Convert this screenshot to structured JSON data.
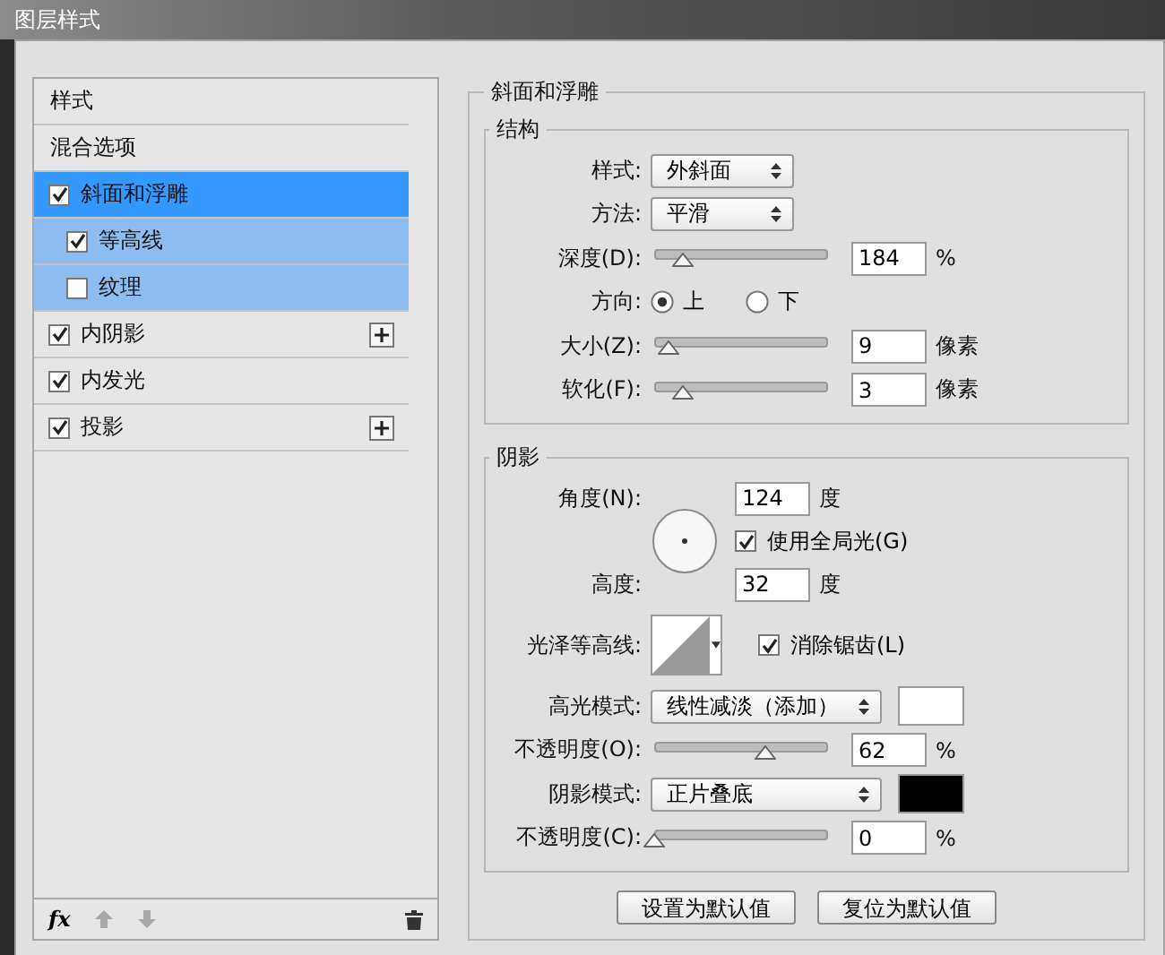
{
  "window": {
    "title": "图层样式"
  },
  "sidebar": {
    "items": [
      {
        "kind": "plain",
        "label": "样式",
        "selected": false
      },
      {
        "kind": "plain",
        "label": "混合选项",
        "selected": false
      },
      {
        "kind": "check",
        "label": "斜面和浮雕",
        "checked": true,
        "selected": true,
        "addable": false,
        "children": [
          {
            "label": "等高线",
            "checked": true,
            "selected": false
          },
          {
            "label": "纹理",
            "checked": false,
            "selected": false
          }
        ]
      },
      {
        "kind": "check",
        "label": "内阴影",
        "checked": true,
        "selected": false,
        "addable": true
      },
      {
        "kind": "check",
        "label": "内发光",
        "checked": true,
        "selected": false,
        "addable": false
      },
      {
        "kind": "check",
        "label": "投影",
        "checked": true,
        "selected": false,
        "addable": true
      }
    ],
    "toolbar": {
      "fx": "fx",
      "buttons": [
        {
          "kind": "up",
          "disabled": true
        },
        {
          "kind": "down",
          "disabled": true
        },
        {
          "kind": "delete",
          "disabled": false
        }
      ]
    }
  },
  "bevel": {
    "title": "斜面和浮雕",
    "structure": {
      "title": "结构",
      "style": {
        "label": "样式:",
        "value": "外斜面"
      },
      "technique": {
        "label": "方法:",
        "value": "平滑"
      },
      "depth": {
        "label": "深度(D):",
        "level": 0.17,
        "value": "184",
        "unit": "%"
      },
      "direction": {
        "label": "方向:",
        "options": [
          {
            "label": "上",
            "selected": true
          },
          {
            "label": "下",
            "selected": false
          }
        ]
      },
      "size": {
        "label": "大小(Z):",
        "level": 0.08,
        "value": "9",
        "unit": "像素"
      },
      "soften": {
        "label": "软化(F):",
        "level": 0.17,
        "value": "3",
        "unit": "像素"
      }
    },
    "shading": {
      "title": "阴影",
      "angle": {
        "label": "角度(N):",
        "value": "124",
        "unit": "度"
      },
      "global_light": {
        "label": "使用全局光(G)",
        "checked": true
      },
      "altitude": {
        "label": "高度:",
        "value": "32",
        "unit": "度"
      },
      "gloss_contour": {
        "label": "光泽等高线:"
      },
      "anti_aliased": {
        "label": "消除锯齿(L)",
        "checked": true
      },
      "highlight_mode": {
        "label": "高光模式:",
        "value": "线性减淡（添加）",
        "color": "#ffffff"
      },
      "highlight_opacity": {
        "label": "不透明度(O):",
        "level": 0.64,
        "value": "62",
        "unit": "%"
      },
      "shadow_mode": {
        "label": "阴影模式:",
        "value": "正片叠底",
        "color": "#000000"
      },
      "shadow_opacity": {
        "label": "不透明度(C):",
        "level": 0,
        "value": "0",
        "unit": "%"
      }
    },
    "buttons": [
      "设置为默认值",
      "复位为默认值"
    ]
  }
}
